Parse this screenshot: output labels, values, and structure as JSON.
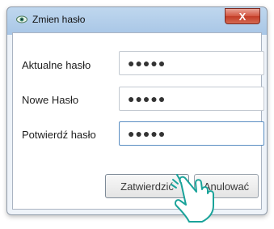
{
  "window": {
    "title": "Zmien hasło",
    "close_symbol": "X",
    "app_icon": "eye-icon"
  },
  "form": {
    "current_password_label": "Aktualne hasło",
    "current_password_value": "●●●●●",
    "new_password_label": "Nowe Hasło",
    "new_password_value": "●●●●●",
    "confirm_password_label": "Potwierdź hasło",
    "confirm_password_value": "●●●●●"
  },
  "buttons": {
    "confirm_label": "Zatwierdzić",
    "cancel_label": "Anulować"
  },
  "overlay": {
    "pointer_icon": "hand-pointer-icon"
  }
}
